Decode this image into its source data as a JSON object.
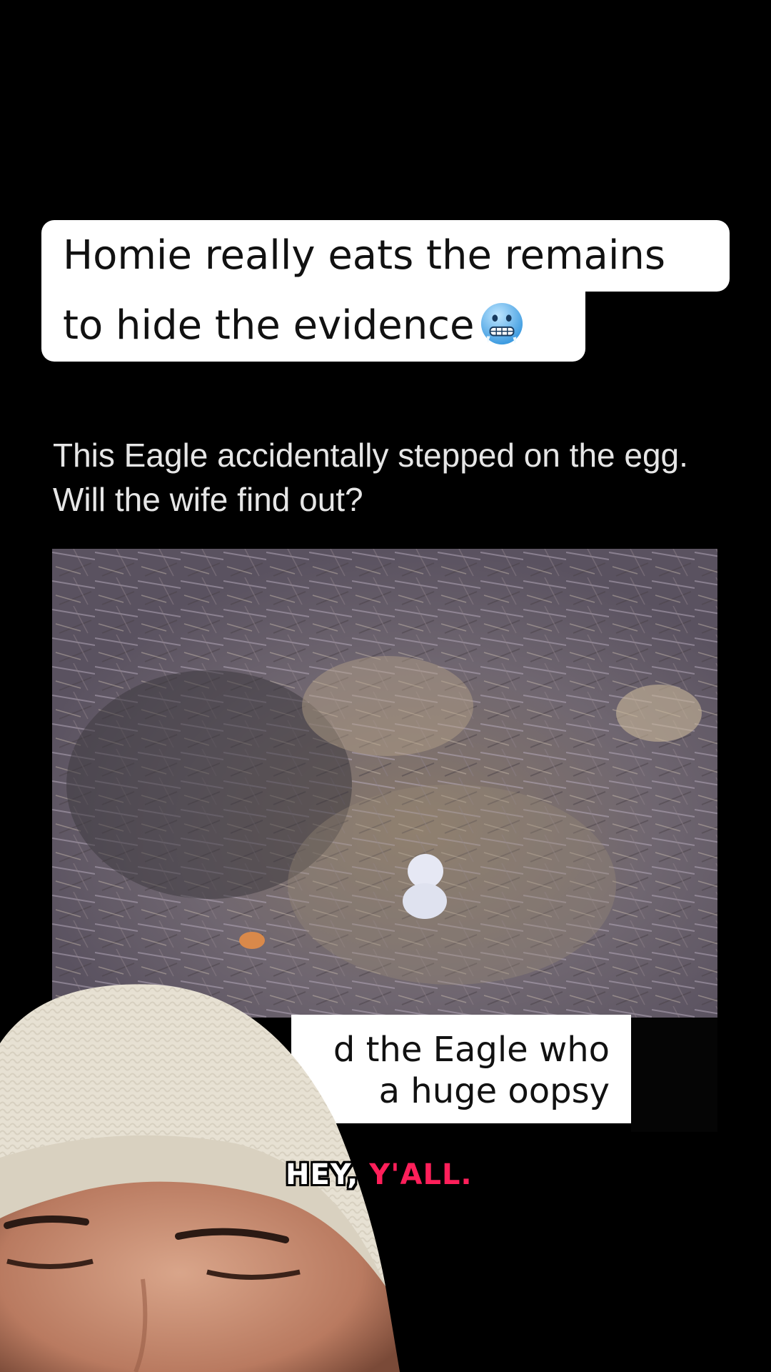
{
  "overlay_caption": {
    "line1": "Homie really eats the remains",
    "line2": "to hide the evidence",
    "emoji": "cold-face-emoji"
  },
  "post": {
    "text": "This Eagle accidentally stepped on the egg. Will the wife find out?"
  },
  "video": {
    "subtitle_line1": "d the Eagle who",
    "subtitle_line2": "a huge oopsy"
  },
  "speech_caption": {
    "word1": "HEY,",
    "word2": "Y'ALL."
  },
  "colors": {
    "background": "#000000",
    "caption_bg": "#ffffff",
    "caption_text": "#111111",
    "speech_highlight": "#ff1f5a"
  }
}
